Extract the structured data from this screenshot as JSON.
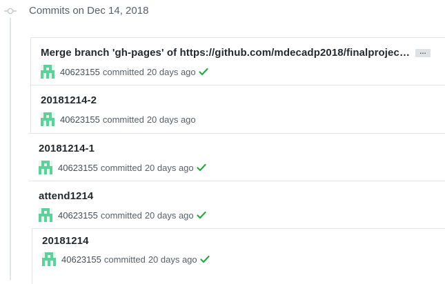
{
  "group": {
    "title": "Commits on Dec 14, 2018"
  },
  "commits": [
    {
      "title": "Merge branch 'gh-pages' of https://github.com/mdecadp2018/finalprojec…",
      "has_ellipsis": true,
      "ellipsis_label": "…",
      "author": "40623155",
      "action": "committed",
      "time": "20 days ago",
      "verified": true
    },
    {
      "title": "20181214-2",
      "author": "40623155",
      "action": "committed",
      "time": "20 days ago",
      "verified": false
    },
    {
      "title": "20181214-1",
      "author": "40623155",
      "action": "committed",
      "time": "20 days ago",
      "verified": true
    },
    {
      "title": "attend1214",
      "author": "40623155",
      "action": "committed",
      "time": "20 days ago",
      "verified": true
    },
    {
      "title": "20181214",
      "author": "40623155",
      "action": "committed",
      "time": "20 days ago",
      "verified": true
    }
  ],
  "icons": {
    "commit_node": "git-commit-icon",
    "avatar": "identicon-avatar",
    "check": "check-icon"
  },
  "colors": {
    "check_green": "#28a745",
    "avatar_green": "#5fcf9b",
    "border": "#e1e4e8",
    "muted_text": "#586069"
  }
}
